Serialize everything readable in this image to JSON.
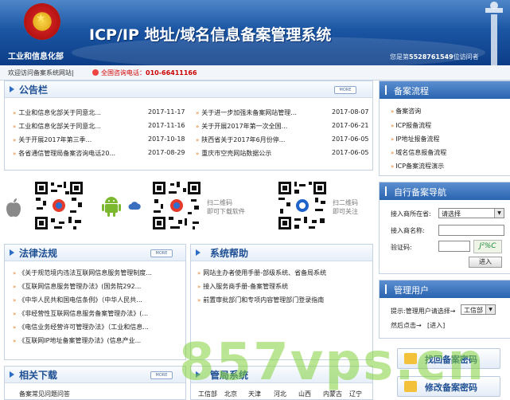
{
  "header": {
    "ministry": "工业和信息化部",
    "title": "ICP/IP 地址/域名信息备案管理系统",
    "visitor_prefix": "您是第",
    "visitor_count": "5528761549",
    "visitor_suffix": "位访问者"
  },
  "subbar": {
    "welcome": "欢迎访问备案系统网站|",
    "hotline_label": "全国咨询电话：",
    "hotline_number": "010-66411166"
  },
  "notice": {
    "title": "公告栏",
    "more": "MORE",
    "items": [
      {
        "text": "工业和信息化部关于同意北...",
        "date": "2017-11-17"
      },
      {
        "text": "关于进一步加强未备案网站管理...",
        "date": "2017-08-07"
      },
      {
        "text": "工业和信息化部关于同意北...",
        "date": "2017-11-16"
      },
      {
        "text": "关于开展2017年第一次全国...",
        "date": "2017-06-21"
      },
      {
        "text": "关于开展2017年第三季...",
        "date": "2017-10-18"
      },
      {
        "text": "陕西省关于2017年6月份停...",
        "date": "2017-06-05"
      },
      {
        "text": "各省通信管理局备案咨询电话20...",
        "date": "2017-08-29"
      },
      {
        "text": "重庆市空壳网站数据公示",
        "date": "2017-06-05"
      }
    ]
  },
  "qr": {
    "tip1": "扫二维码",
    "tip2": "即可下载软件",
    "tip3": "扫二维码",
    "tip4": "即可关注"
  },
  "laws": {
    "title": "法律法规",
    "more": "MORE",
    "items": [
      "《关于规范境内违法互联网信息服务管理制度...",
      "《互联网信息服务管理办法》(国务院292...",
      "《中华人民共和国电信条例》（中华人民共...",
      "《非经营性互联网信息服务备案管理办法》(...",
      "《电信业务经营许可管理办法》（工业和信息...",
      "《互联网IP地址备案管理办法》(信息产业..."
    ]
  },
  "help": {
    "title": "系统帮助",
    "items": [
      "网站主办者使用手册-部级系统、省备局系统",
      "接入服务商手册-备案管理系统",
      "前置审批部门和专项内容管理部门登录指南"
    ]
  },
  "downloads": {
    "title": "相关下载",
    "more": "MORE",
    "items": [
      "备案常见问题问答"
    ]
  },
  "bureaus": {
    "title": "管局系统",
    "items": [
      "工信部",
      "北京",
      "天津",
      "河北",
      "山西",
      "内蒙古",
      "辽宁"
    ]
  },
  "flow": {
    "title": "备案流程",
    "items": [
      "备案咨询",
      "ICP报备流程",
      "IP地址报备流程",
      "域名信息报备流程",
      "ICP备案流程演示"
    ]
  },
  "nav": {
    "title": "自行备案导航",
    "location_label": "接入商所在省:",
    "location_value": "请选择",
    "name_label": "接入商名称:",
    "captcha_label": "验证码:",
    "captcha_value": "J²%C",
    "enter": "进入"
  },
  "admin": {
    "title": "管理用户",
    "prompt": "提示:管理用户请选择→",
    "select_value": "工信部",
    "then_click": "然后点击→",
    "enter": "[进入]"
  },
  "buttons": {
    "find_password": "找回备案密码",
    "modify_password": "修改备案密码"
  },
  "watermark": "857vps.cn"
}
